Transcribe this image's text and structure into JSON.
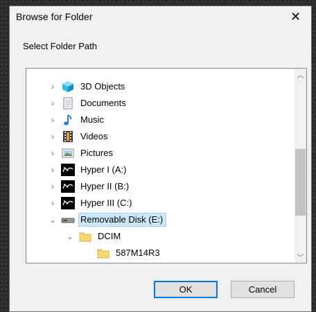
{
  "dialog": {
    "title": "Browse for Folder",
    "close_glyph": "✕",
    "prompt": "Select Folder Path"
  },
  "tree": {
    "items": [
      {
        "label": "3D Objects",
        "icon": "3d-objects-icon",
        "expander": "›"
      },
      {
        "label": "Documents",
        "icon": "documents-icon",
        "expander": "›"
      },
      {
        "label": "Music",
        "icon": "music-icon",
        "expander": "›"
      },
      {
        "label": "Videos",
        "icon": "videos-icon",
        "expander": "›"
      },
      {
        "label": "Pictures",
        "icon": "pictures-icon",
        "expander": "›"
      },
      {
        "label": "Hyper I (A:)",
        "icon": "drive-icon",
        "expander": "›"
      },
      {
        "label": "Hyper II (B:)",
        "icon": "drive-icon",
        "expander": "›"
      },
      {
        "label": "Hyper III (C:)",
        "icon": "drive-icon",
        "expander": "›"
      },
      {
        "label": "Removable Disk (E:)",
        "icon": "removable-disk-icon",
        "expander": "⌄",
        "selected": true
      },
      {
        "label": "DCIM",
        "icon": "folder-icon",
        "expander": "⌄"
      },
      {
        "label": "587M14R3",
        "icon": "folder-icon",
        "expander": ""
      }
    ]
  },
  "scroll": {
    "up_glyph": "︿",
    "down_glyph": "﹀"
  },
  "buttons": {
    "ok": "OK",
    "cancel": "Cancel"
  },
  "colors": {
    "selection": "#cce8ff",
    "accent": "#0078d7",
    "folder": "#f8d775"
  }
}
